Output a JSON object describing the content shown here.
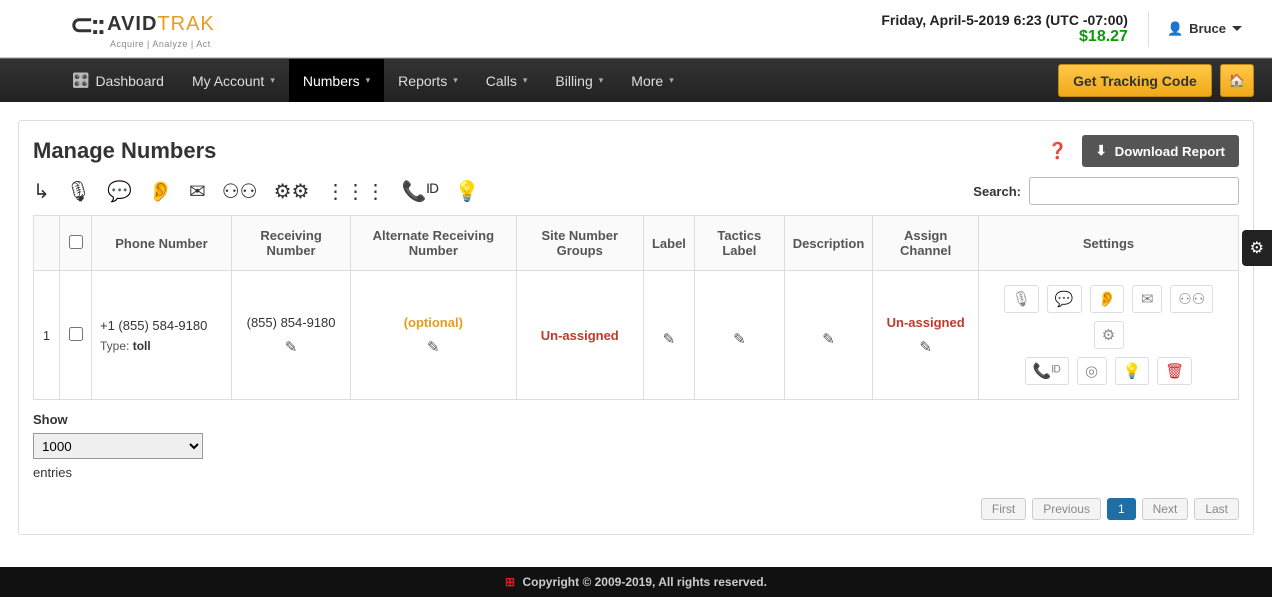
{
  "header": {
    "logo_main1": "AVID",
    "logo_main2": "TRAK",
    "logo_tag": "Acquire  |  Analyze  |  Act",
    "datetime": "Friday, April-5-2019 6:23 (UTC -07:00)",
    "balance": "$18.27",
    "user_name": "Bruce"
  },
  "nav": {
    "dashboard": "Dashboard",
    "my_account": "My Account",
    "numbers": "Numbers",
    "reports": "Reports",
    "calls": "Calls",
    "billing": "Billing",
    "more": "More",
    "tracking_code": "Get Tracking Code"
  },
  "page": {
    "title": "Manage Numbers",
    "download": "Download Report",
    "search_label": "Search:"
  },
  "table": {
    "headers": {
      "phone_number": "Phone Number",
      "receiving_number": "Receiving Number",
      "alt_receiving": "Alternate Receiving Number",
      "site_groups": "Site Number Groups",
      "label": "Label",
      "tactics_label": "Tactics Label",
      "description": "Description",
      "assign_channel": "Assign Channel",
      "settings": "Settings"
    },
    "row": {
      "index": "1",
      "phone": "+1 (855) 584-9180",
      "type_label": "Type:",
      "type_value": "toll",
      "receiving": "(855) 854-9180",
      "alt_text": "(optional)",
      "site_groups": "Un-assigned",
      "assign_channel": "Un-assigned"
    }
  },
  "below": {
    "show": "Show",
    "entries_value": "1000",
    "entries": "entries"
  },
  "pagination": {
    "first": "First",
    "previous": "Previous",
    "page1": "1",
    "next": "Next",
    "last": "Last"
  },
  "footer": {
    "text": "Copyright © 2009-2019, All rights reserved."
  }
}
